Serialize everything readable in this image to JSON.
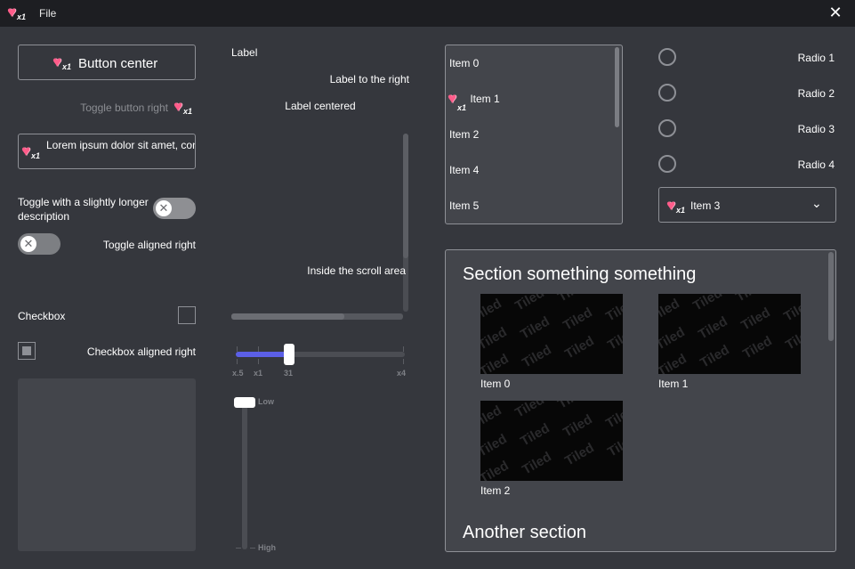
{
  "titlebar": {
    "menu_file": "File",
    "close": "✕"
  },
  "badge": "x1",
  "column1": {
    "button_center": "Button center",
    "toggle_button_right": "Toggle button right",
    "text_field": "Lorem ipsum dolor sit amet, consectetur adipiscing elit, sed",
    "toggle_long": "Toggle with a slightly longer description",
    "toggle_right": "Toggle aligned right",
    "checkbox": "Checkbox",
    "checkbox_right": "Checkbox aligned right"
  },
  "column2": {
    "label": "Label",
    "label_right": "Label to the right",
    "label_centered": "Label centered",
    "inside_scroll": "Inside the scroll area",
    "hslider": {
      "value": "31",
      "ticks": [
        "x.5",
        "x1",
        "31",
        "x4"
      ]
    },
    "vslider": {
      "low": "Low",
      "high": "High"
    }
  },
  "list": {
    "items": [
      "Item 0",
      "Item 1",
      "Item 2",
      "Item 4",
      "Item 5"
    ]
  },
  "radios": [
    "Radio 1",
    "Radio 2",
    "Radio 3",
    "Radio 4"
  ],
  "dropdown": {
    "selected": "Item 3"
  },
  "section": {
    "title": "Section something something",
    "tile_text": "Tiled",
    "tiles": [
      "Item 0",
      "Item 1",
      "Item 2"
    ],
    "title2": "Another section"
  },
  "colors": {
    "accent": "#5b5fe6",
    "background": "#35373d",
    "titlebar": "#1d1e22"
  }
}
